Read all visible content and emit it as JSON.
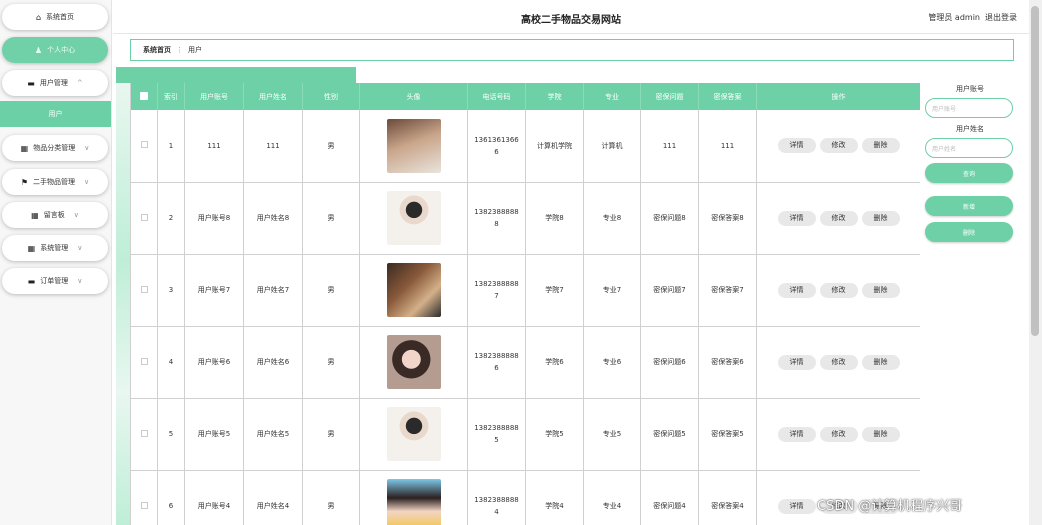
{
  "header": {
    "title": "高校二手物品交易网站",
    "user": "管理员 admin",
    "logout": "退出登录"
  },
  "sidebar": {
    "items": [
      {
        "label": "系统首页",
        "icon": "home-icon",
        "glyph": "⌂",
        "chevron": ""
      },
      {
        "label": "个人中心",
        "icon": "user-icon",
        "glyph": "♟",
        "chevron": ""
      },
      {
        "label": "用户管理",
        "icon": "users-icon",
        "glyph": "▬",
        "chevron": "^"
      },
      {
        "label": "物品分类管理",
        "icon": "grid-icon",
        "glyph": "▦",
        "chevron": "∨"
      },
      {
        "label": "二手物品管理",
        "icon": "flag-icon",
        "glyph": "⚑",
        "chevron": "∨"
      },
      {
        "label": "留言板",
        "icon": "message-board-icon",
        "glyph": "▦",
        "chevron": "∨"
      },
      {
        "label": "系统管理",
        "icon": "settings-grid-icon",
        "glyph": "▦",
        "chevron": "∨"
      },
      {
        "label": "订单管理",
        "icon": "order-icon",
        "glyph": "▬",
        "chevron": "∨"
      }
    ],
    "submenu": "用户"
  },
  "breadcrumb": {
    "home": "系统首页",
    "separator": "⋮",
    "current": "用户"
  },
  "table": {
    "headers": [
      "索引",
      "用户账号",
      "用户姓名",
      "性别",
      "头像",
      "电话号码",
      "学院",
      "专业",
      "密保问题",
      "密保答案",
      "操作"
    ],
    "actions": [
      "详情",
      "修改",
      "删除"
    ],
    "rows": [
      {
        "index": "1",
        "account": "111",
        "name": "111",
        "gender": "男",
        "phone": "13613613666",
        "college": "计算机学院",
        "major": "计算机",
        "question": "111",
        "answer": "111"
      },
      {
        "index": "2",
        "account": "用户账号8",
        "name": "用户姓名8",
        "gender": "男",
        "phone": "13823888888",
        "college": "学院8",
        "major": "专业8",
        "question": "密保问题8",
        "answer": "密保答案8"
      },
      {
        "index": "3",
        "account": "用户账号7",
        "name": "用户姓名7",
        "gender": "男",
        "phone": "13823888887",
        "college": "学院7",
        "major": "专业7",
        "question": "密保问题7",
        "answer": "密保答案7"
      },
      {
        "index": "4",
        "account": "用户账号6",
        "name": "用户姓名6",
        "gender": "男",
        "phone": "13823888886",
        "college": "学院6",
        "major": "专业6",
        "question": "密保问题6",
        "answer": "密保答案6"
      },
      {
        "index": "5",
        "account": "用户账号5",
        "name": "用户姓名5",
        "gender": "男",
        "phone": "13823888885",
        "college": "学院5",
        "major": "专业5",
        "question": "密保问题5",
        "answer": "密保答案5"
      },
      {
        "index": "6",
        "account": "用户账号4",
        "name": "用户姓名4",
        "gender": "男",
        "phone": "13823888884",
        "college": "学院4",
        "major": "专业4",
        "question": "密保问题4",
        "answer": "密保答案4"
      }
    ]
  },
  "search": {
    "account_label": "用户账号",
    "account_placeholder": "用户账号",
    "name_label": "用户姓名",
    "name_placeholder": "用户姓名",
    "query_button": "查询",
    "add_button": "新增",
    "delete_button": "删除"
  },
  "watermark": "CSDN @计算机程序兴哥",
  "colors": {
    "accent": "#6dd0a7",
    "active_menu": "#70d1a8"
  }
}
